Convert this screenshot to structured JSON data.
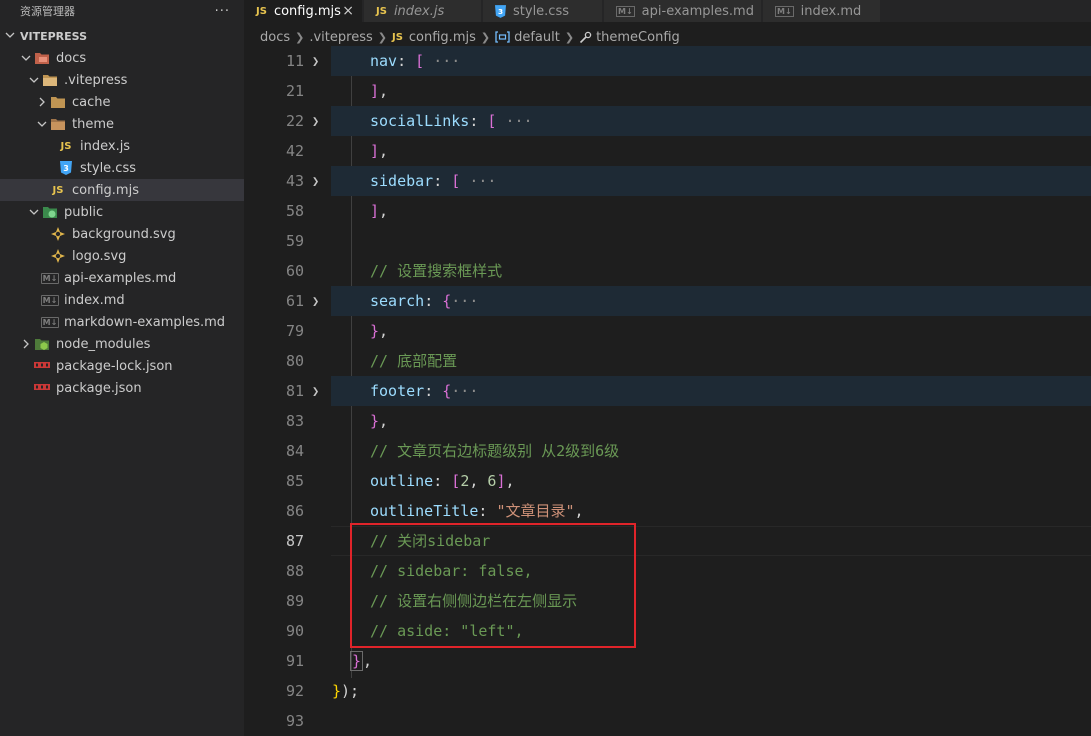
{
  "explorer": {
    "title": "资源管理器",
    "more_label": "···",
    "workspace": "VITEPRESS"
  },
  "tree": [
    {
      "label": "docs",
      "icon": "folder-docs-icon",
      "expanded": true
    },
    {
      "label": ".vitepress",
      "icon": "folder-icon",
      "expanded": true
    },
    {
      "label": "cache",
      "icon": "folder-icon",
      "expanded": false
    },
    {
      "label": "theme",
      "icon": "folder-theme-icon",
      "expanded": true
    },
    {
      "label": "index.js",
      "icon": "js-file-icon"
    },
    {
      "label": "style.css",
      "icon": "css-file-icon"
    },
    {
      "label": "config.mjs",
      "icon": "js-file-icon",
      "selected": true
    },
    {
      "label": "public",
      "icon": "folder-public-icon",
      "expanded": true
    },
    {
      "label": "background.svg",
      "icon": "svg-file-icon"
    },
    {
      "label": "logo.svg",
      "icon": "svg-file-icon"
    },
    {
      "label": "api-examples.md",
      "icon": "markdown-file-icon"
    },
    {
      "label": "index.md",
      "icon": "markdown-file-icon"
    },
    {
      "label": "markdown-examples.md",
      "icon": "markdown-file-icon"
    },
    {
      "label": "node_modules",
      "icon": "folder-node-icon",
      "expanded": false
    },
    {
      "label": "package-lock.json",
      "icon": "npm-file-icon"
    },
    {
      "label": "package.json",
      "icon": "npm-file-icon"
    }
  ],
  "tabs": [
    {
      "label": "config.mjs",
      "icon": "JS",
      "active": true,
      "close": "×"
    },
    {
      "label": "index.js",
      "icon": "JS"
    },
    {
      "label": "style.css",
      "icon": "css"
    },
    {
      "label": "api-examples.md",
      "icon": "M↓"
    },
    {
      "label": "index.md",
      "icon": "M↓"
    }
  ],
  "icon_text": {
    "js": "JS",
    "md": "M↓"
  },
  "breadcrumb": {
    "items": [
      "docs",
      ".vitepress",
      "config.mjs",
      "default",
      "themeConfig"
    ]
  },
  "editor": {
    "line_numbers": [
      "11",
      "21",
      "22",
      "42",
      "43",
      "58",
      "59",
      "60",
      "61",
      "79",
      "80",
      "81",
      "83",
      "84",
      "85",
      "86",
      "87",
      "88",
      "89",
      "90",
      "91",
      "92",
      "93"
    ],
    "current_line": "87",
    "code": {
      "l11": "nav",
      "l22": "socialLinks",
      "l43": "sidebar",
      "l60": "// 设置搜索框样式",
      "l61": "search",
      "l80": "// 底部配置",
      "l81": "footer",
      "l84": "// 文章页右边标题级别 从2级到6级",
      "l85_key": "outline",
      "l85_v1": "2",
      "l85_v2": "6",
      "l86_key": "outlineTitle",
      "l86_val": "\"文章目录\"",
      "l87": "// 关闭sidebar",
      "l88": "// sidebar: false,",
      "l89": "// 设置右侧侧边栏在左侧显示",
      "l90": "// aside: \"left\","
    },
    "ellipsis": "···"
  },
  "colors": {
    "highlight_box": "#e0242a",
    "accent_js": "#e8c44f",
    "accent_css": "#42a5f5"
  }
}
